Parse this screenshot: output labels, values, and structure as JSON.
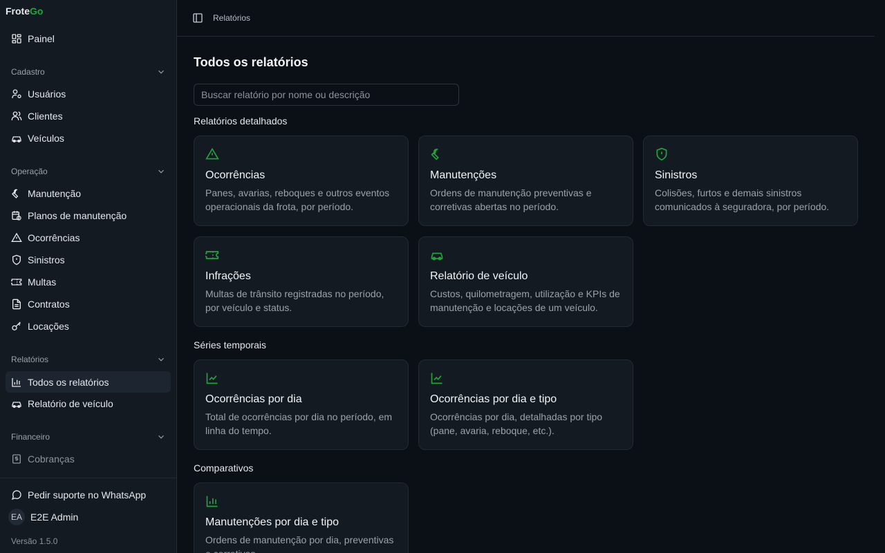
{
  "brand": {
    "part1": "Frote",
    "part2": "Go"
  },
  "sidebar": {
    "painel": "Painel",
    "groups": {
      "cadastro": "Cadastro",
      "operacao": "Operação",
      "relatorios": "Relatórios",
      "financeiro": "Financeiro"
    },
    "cadastro": [
      "Usuários",
      "Clientes",
      "Veículos"
    ],
    "operacao": [
      "Manutenção",
      "Planos de manutenção",
      "Ocorrências",
      "Sinistros",
      "Multas",
      "Contratos",
      "Locações"
    ],
    "relatorios": [
      "Todos os relatórios",
      "Relatório de veículo"
    ],
    "financeiro": [
      "Cobranças"
    ],
    "support": "Pedir suporte no WhatsApp",
    "user": {
      "initials": "EA",
      "name": "E2E Admin"
    },
    "version": "Versão 1.5.0"
  },
  "header": {
    "breadcrumb": "Relatórios"
  },
  "main": {
    "title": "Todos os relatórios",
    "search_placeholder": "Buscar relatório por nome ou descrição",
    "sections": {
      "detalhados": "Relatórios detalhados",
      "series": "Séries temporais",
      "comparativos": "Comparativos"
    },
    "cards": [
      {
        "title": "Ocorrências",
        "desc": "Panes, avarias, reboques e outros eventos operacionais da frota, por período.",
        "icon": "alert-triangle-icon"
      },
      {
        "title": "Manutenções",
        "desc": "Ordens de manutenção preventivas e corretivas abertas no período.",
        "icon": "wrench-icon"
      },
      {
        "title": "Sinistros",
        "desc": "Colisões, furtos e demais sinistros comunicados à seguradora, por período.",
        "icon": "shield-alert-icon"
      },
      {
        "title": "Infrações",
        "desc": "Multas de trânsito registradas no período, por veículo e status.",
        "icon": "ticket-icon"
      },
      {
        "title": "Relatório de veículo",
        "desc": "Custos, quilometragem, utilização e KPIs de manutenção e locações de um veículo.",
        "icon": "car-icon"
      },
      {
        "title": "Ocorrências por dia",
        "desc": "Total de ocorrências por dia no período, em linha do tempo.",
        "icon": "line-chart-icon"
      },
      {
        "title": "Ocorrências por dia e tipo",
        "desc": "Ocorrências por dia, detalhadas por tipo (pane, avaria, reboque, etc.).",
        "icon": "line-chart-icon"
      },
      {
        "title": "Manutenções por dia e tipo",
        "desc": "Ordens de manutenção por dia, preventivas e corretivas.",
        "icon": "bar-chart-icon"
      }
    ]
  },
  "colors": {
    "accent": "#22a33b",
    "background": "#0b0f16",
    "sidebar": "#141a22",
    "card": "#141a22",
    "border": "#232a34"
  }
}
